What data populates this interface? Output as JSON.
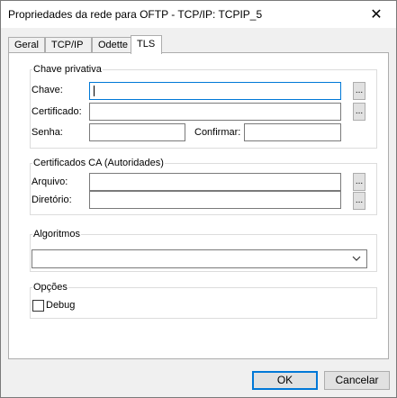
{
  "window": {
    "title": "Propriedades da rede para OFTP - TCP/IP: TCPIP_5",
    "close_glyph": "✕"
  },
  "tabs": [
    {
      "label": "Geral",
      "active": false
    },
    {
      "label": "TCP/IP",
      "active": false
    },
    {
      "label": "Odette",
      "active": false
    },
    {
      "label": "TLS",
      "active": true
    }
  ],
  "private_key": {
    "title": "Chave privativa",
    "chave_label": "Chave:",
    "chave_value": "",
    "certificado_label": "Certificado:",
    "certificado_value": "",
    "senha_label": "Senha:",
    "senha_value": "",
    "confirmar_label": "Confirmar:",
    "confirmar_value": "",
    "browse_label": "..."
  },
  "ca_certs": {
    "title": "Certificados CA (Autoridades)",
    "arquivo_label": "Arquivo:",
    "arquivo_value": "",
    "diretorio_label": "Diretório:",
    "diretorio_value": "",
    "browse_label": "..."
  },
  "algorithms": {
    "title": "Algoritmos",
    "selected": ""
  },
  "options": {
    "title": "Opções",
    "debug_label": "Debug",
    "debug_checked": false
  },
  "footer": {
    "ok_label": "OK",
    "cancel_label": "Cancelar"
  },
  "icons": {
    "close": "close-icon",
    "dropdown": "chevron-down-icon"
  },
  "colors": {
    "focus_border": "#0078d7",
    "panel_bg": "#ffffff",
    "window_bg": "#f0f0f0"
  }
}
